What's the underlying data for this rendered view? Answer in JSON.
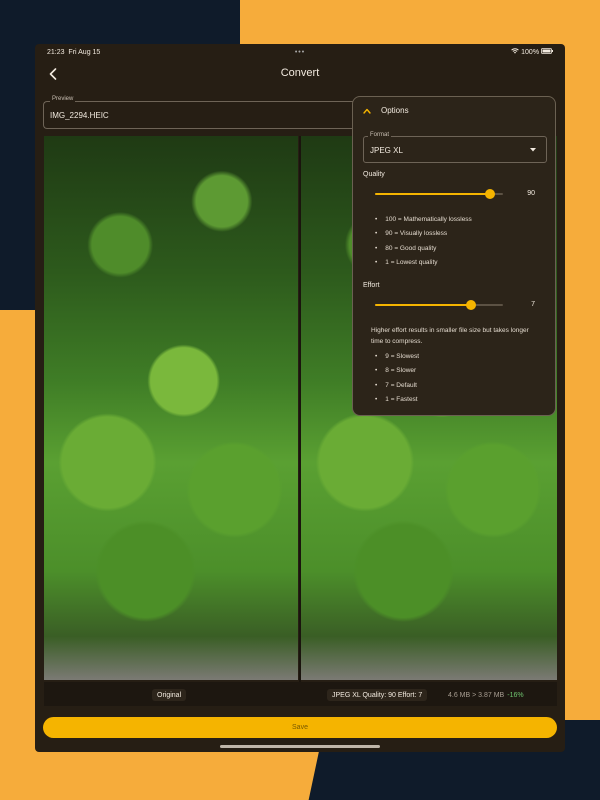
{
  "status": {
    "time": "21:23",
    "date": "Fri Aug 15",
    "battery": "100%"
  },
  "nav": {
    "title": "Convert"
  },
  "preview": {
    "legend": "Preview",
    "filename": "IMG_2294.HEIC"
  },
  "options": {
    "title": "Options",
    "format_legend": "Format",
    "format_value": "JPEG XL",
    "quality": {
      "label": "Quality",
      "value": 90,
      "value_text": "90",
      "min": 1,
      "max": 100,
      "hints": [
        "100 = Mathematically lossless",
        "90 = Visually lossless",
        "80 = Good quality",
        "1 = Lowest quality"
      ]
    },
    "effort": {
      "label": "Effort",
      "value": 7,
      "value_text": "7",
      "min": 1,
      "max": 9,
      "note": "Higher effort results in smaller file size but takes longer time to compress.",
      "hints": [
        "9 = Slowest",
        "8 = Slower",
        "7 = Default",
        "1 = Fastest"
      ]
    }
  },
  "captions": {
    "original": "Original",
    "converted": "JPEG XL Quality: 90 Effort: 7",
    "sizes": "4.6 MB > 3.87 MB",
    "change": "-16%"
  },
  "save_label": "Save",
  "colors": {
    "accent": "#f5b400",
    "background": "#261e14",
    "page_background": "#f6ac3b",
    "savings": "#6fc36f"
  }
}
